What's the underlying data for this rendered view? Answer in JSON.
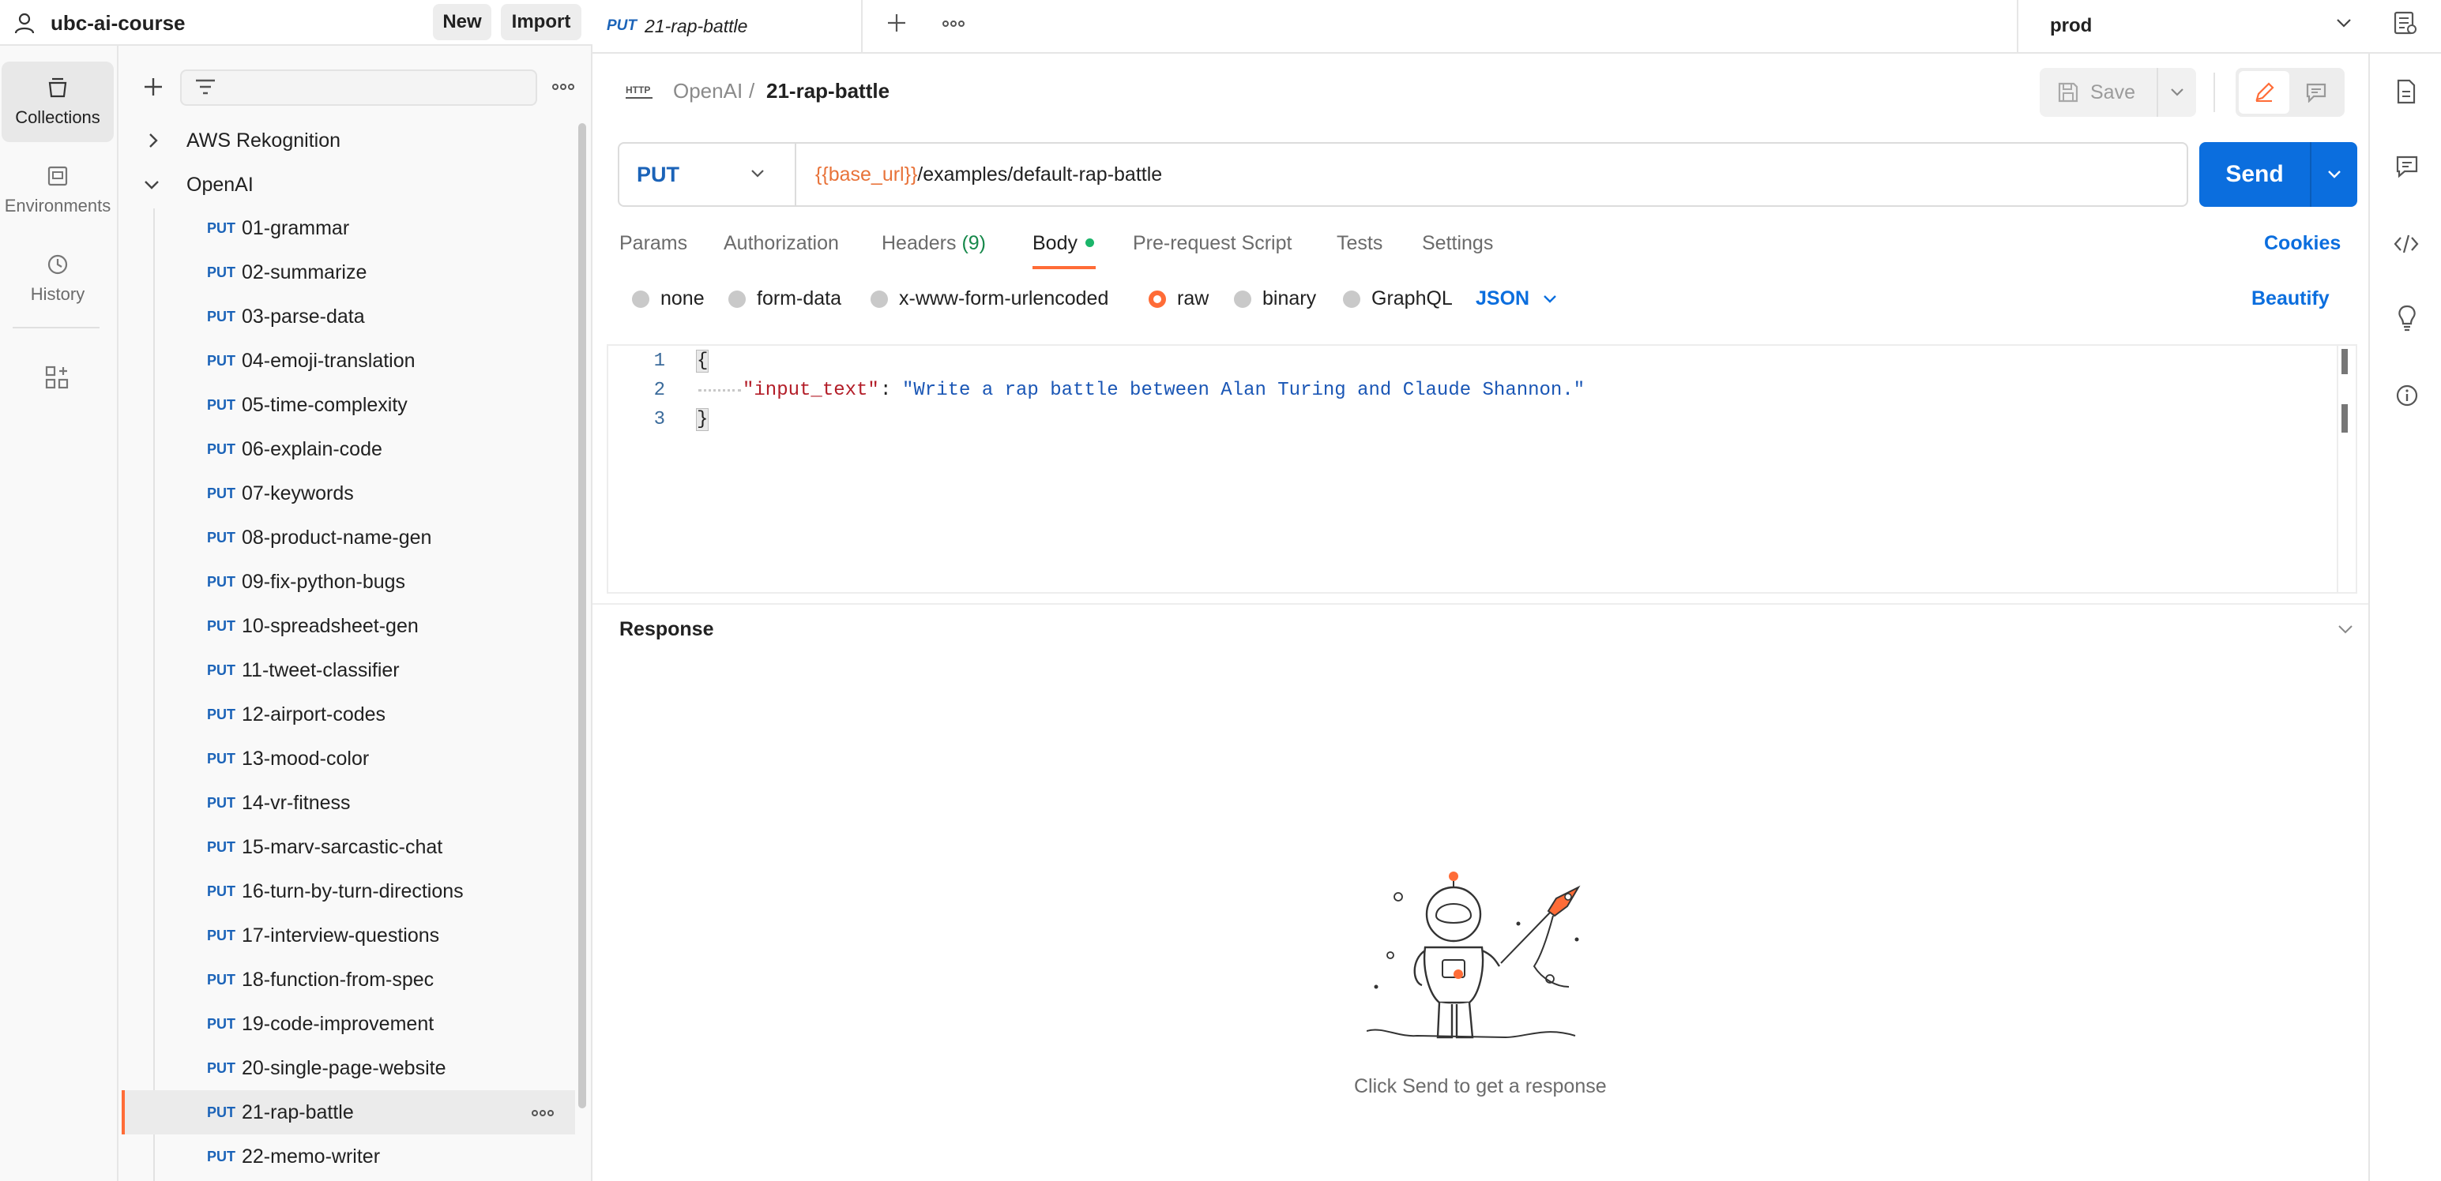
{
  "workspace": {
    "name": "ubc-ai-course",
    "new_label": "New",
    "import_label": "Import"
  },
  "rail": {
    "collections": "Collections",
    "environments": "Environments",
    "history": "History"
  },
  "sidebar": {
    "folders": [
      {
        "name": "AWS Rekognition",
        "expanded": false
      },
      {
        "name": "OpenAI",
        "expanded": true
      }
    ],
    "requests": [
      {
        "method": "PUT",
        "name": "01-grammar"
      },
      {
        "method": "PUT",
        "name": "02-summarize"
      },
      {
        "method": "PUT",
        "name": "03-parse-data"
      },
      {
        "method": "PUT",
        "name": "04-emoji-translation"
      },
      {
        "method": "PUT",
        "name": "05-time-complexity"
      },
      {
        "method": "PUT",
        "name": "06-explain-code"
      },
      {
        "method": "PUT",
        "name": "07-keywords"
      },
      {
        "method": "PUT",
        "name": "08-product-name-gen"
      },
      {
        "method": "PUT",
        "name": "09-fix-python-bugs"
      },
      {
        "method": "PUT",
        "name": "10-spreadsheet-gen"
      },
      {
        "method": "PUT",
        "name": "11-tweet-classifier"
      },
      {
        "method": "PUT",
        "name": "12-airport-codes"
      },
      {
        "method": "PUT",
        "name": "13-mood-color"
      },
      {
        "method": "PUT",
        "name": "14-vr-fitness"
      },
      {
        "method": "PUT",
        "name": "15-marv-sarcastic-chat"
      },
      {
        "method": "PUT",
        "name": "16-turn-by-turn-directions"
      },
      {
        "method": "PUT",
        "name": "17-interview-questions"
      },
      {
        "method": "PUT",
        "name": "18-function-from-spec"
      },
      {
        "method": "PUT",
        "name": "19-code-improvement"
      },
      {
        "method": "PUT",
        "name": "20-single-page-website"
      },
      {
        "method": "PUT",
        "name": "21-rap-battle",
        "selected": true
      },
      {
        "method": "PUT",
        "name": "22-memo-writer"
      }
    ]
  },
  "tab": {
    "method": "PUT",
    "name": "21-rap-battle"
  },
  "environment": {
    "selected": "prod"
  },
  "breadcrumb": {
    "parent": "OpenAI",
    "separator": "/",
    "current": "21-rap-battle"
  },
  "toolbar": {
    "save_label": "Save"
  },
  "request": {
    "method": "PUT",
    "url_variable": "{{base_url}}",
    "url_path": "/examples/default-rap-battle",
    "send_label": "Send"
  },
  "subtabs": {
    "params": "Params",
    "authorization": "Authorization",
    "headers": "Headers",
    "headers_count": "(9)",
    "body": "Body",
    "prerequest": "Pre-request Script",
    "tests": "Tests",
    "settings": "Settings",
    "cookies": "Cookies"
  },
  "body_modes": {
    "none": "none",
    "form_data": "form-data",
    "urlencoded": "x-www-form-urlencoded",
    "raw": "raw",
    "binary": "binary",
    "graphql": "GraphQL",
    "format": "JSON",
    "beautify": "Beautify",
    "selected": "raw"
  },
  "editor": {
    "lines": [
      "1",
      "2",
      "3"
    ],
    "open_brace": "{",
    "close_brace": "}",
    "key": "\"input_text\"",
    "colon": ":",
    "value": "\"Write a rap battle between Alan Turing and Claude Shannon.\""
  },
  "response": {
    "title": "Response",
    "empty_text": "Click Send to get a response"
  },
  "colors": {
    "accent": "#ff6c37",
    "primary": "#0b6ede",
    "method_put": "#1b63b8",
    "json_key": "#b31d28",
    "json_string": "#1a56b5"
  }
}
